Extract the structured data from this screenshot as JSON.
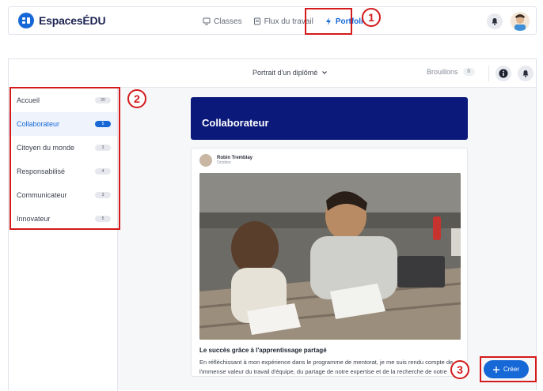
{
  "header": {
    "logo_text": "EspacesÉDU",
    "nav": [
      {
        "label": "Classes",
        "icon": "classes-icon"
      },
      {
        "label": "Flux du travail",
        "icon": "workflow-icon"
      },
      {
        "label": "Portfolios",
        "icon": "portfolio-icon",
        "active": true
      }
    ]
  },
  "subbar": {
    "title": "Portrait d'un diplômé",
    "drafts_label": "Brouillons",
    "drafts_count": "0"
  },
  "sidebar": {
    "items": [
      {
        "label": "Accueil",
        "count": "20"
      },
      {
        "label": "Collaborateur",
        "count": "5",
        "active": true
      },
      {
        "label": "Citoyen du monde",
        "count": "3"
      },
      {
        "label": "Responsabilisé",
        "count": "4"
      },
      {
        "label": "Communicateur",
        "count": "3"
      },
      {
        "label": "Innovateur",
        "count": "5"
      }
    ]
  },
  "section": {
    "title": "Collaborateur"
  },
  "post": {
    "author": "Robin Tremblay",
    "date": "Octobre",
    "title": "Le succès grâce à l'apprentissage partagé",
    "body": "En réfléchissant à mon expérience dans le programme de mentorat, je me suis rendu compte de l'immense valeur du travail d'équipe, du partage de notre expertise et de la recherche de notre réussite collective dans un environnem..."
  },
  "create_button": {
    "label": "Créer"
  },
  "annotations": [
    "1",
    "2",
    "3"
  ],
  "colors": {
    "accent": "#1668d6",
    "hero": "#0b1a7a",
    "annotation": "#d41a1a"
  }
}
